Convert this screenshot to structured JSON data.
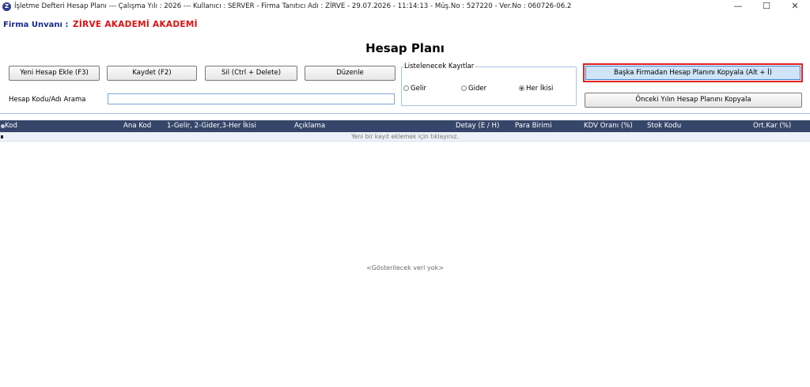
{
  "window": {
    "title": "İşletme Defteri Hesap Planı  ---  Çalışma Yılı : 2026  ---  Kullanıcı : SERVER - Firma Tanıtıcı Adı : ZİRVE - 29.07.2026 - 11:14:13 - Müş.No : 527220 - Ver.No : 060726-06.2",
    "icon_glyph": "Z",
    "minimize_glyph": "—",
    "maximize_glyph": "☐",
    "close_glyph": "✕"
  },
  "firma": {
    "label": "Firma Unvanı :",
    "value": "ZİRVE AKADEMİ AKADEMİ"
  },
  "page_title": "Hesap Planı",
  "toolbar": {
    "add": "Yeni Hesap Ekle (F3)",
    "save": "Kaydet (F2)",
    "delete": "Sil (Ctrl + Delete)",
    "edit": "Düzenle"
  },
  "search": {
    "label": "Hesap Kodu/Adı Arama",
    "value": ""
  },
  "filter": {
    "legend": "Listelenecek Kayıtlar",
    "options": [
      "Gelir",
      "Gider",
      "Her İkisi"
    ],
    "selected": "Her İkisi"
  },
  "copy_buttons": {
    "other_company": "Başka Firmadan Hesap Planını Kopyala (Alt + İ)",
    "previous_year": "Önceki Yılın Hesap Planını Kopyala"
  },
  "grid": {
    "columns": [
      "Kod",
      "Ana Kod",
      "1-Gelir, 2-Gider,3-Her İkisi",
      "Açıklama",
      "Detay (E / H)",
      "Para Birimi",
      "KDV Oranı (%)",
      "Stok Kodu",
      "Ort.Kar (%)"
    ],
    "new_row_hint": "Yeni bir kayıt eklemek için tıklayınız.",
    "empty_text": "<Gösterilecek veri yok>"
  },
  "colors": {
    "header_bg": "#36466a",
    "firma_label": "#1a2a8c",
    "firma_value": "#e01010",
    "highlight_border": "#e02020"
  }
}
